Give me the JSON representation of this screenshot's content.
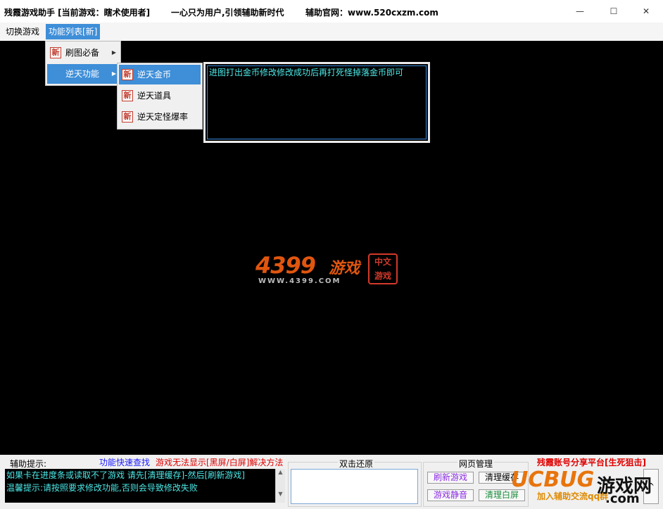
{
  "window": {
    "title": "残霞游戏助手 [当前游戏：瞎术使用者]",
    "slogan": "一心只为用户,引领辅助新时代",
    "website": "辅助官网：www.520cxzm.com",
    "minimize_glyph": "—",
    "maximize_glyph": "☐",
    "close_glyph": "✕"
  },
  "menubar": {
    "items": [
      {
        "label": "切换游戏"
      },
      {
        "label": "功能列表[新]"
      }
    ]
  },
  "dropdown": {
    "items": [
      {
        "label": "刷图必备",
        "icon": "新"
      },
      {
        "label": "逆天功能",
        "icon": ""
      }
    ],
    "arrow": "▶"
  },
  "submenu": {
    "items": [
      {
        "label": "逆天金币",
        "icon": "新"
      },
      {
        "label": "逆天道具",
        "icon": "新"
      },
      {
        "label": "逆天定怪爆率",
        "icon": "新"
      }
    ]
  },
  "tip_box": {
    "text": "进图打出金币修改修改成功后再打死怪掉落金币即可"
  },
  "logo": {
    "number": "4399",
    "game": "游戏",
    "url": "WWW.4399.COM",
    "seal_line1": "中文",
    "seal_line2": "游戏"
  },
  "bottom": {
    "hint_label": "辅助提示:",
    "quick_search": "功能快速查找",
    "fix_black_screen": "游戏无法显示[黑屏/白屏]解决方法",
    "hint_line1": "如果卡在进度条或读取不了游戏 请先[清理缓存]-然后[刷新游戏]",
    "hint_line2": "温馨提示:请按照要求修改功能,否则会导致修改失败",
    "double_click_restore": "双击还原",
    "web_manage": "网页管理",
    "refresh_game": "刷新游戏",
    "clear_cache": "清理缓存",
    "mute_game": "游戏静音",
    "clear_white": "清理白屏",
    "account_share": "残霞账号分享平台[生死狙击]",
    "join_group": "加入辅助交流qq群",
    "scroll_up": "▲",
    "scroll_down": "▼",
    "expand_glyph": "^"
  },
  "watermark": {
    "brand": "UCBUG",
    "game": "游戏网",
    "com": ".com"
  },
  "colors": {
    "accent": "#3e8ed8",
    "cyan_text": "#4de8e8",
    "red_text": "#e00000",
    "blue_link": "#1a1aff",
    "logo_orange": "#e0560f"
  }
}
